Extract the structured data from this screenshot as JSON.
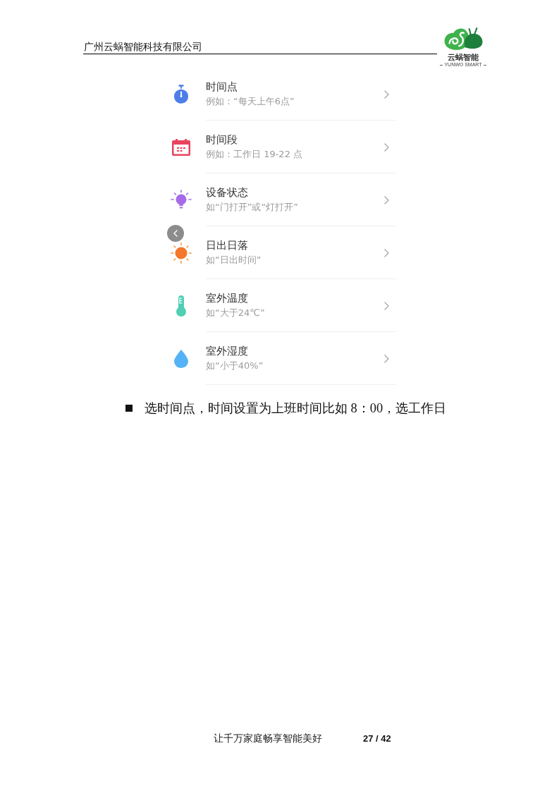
{
  "header": {
    "company": "广州云蜗智能科技有限公司",
    "logo": {
      "name": "云蜗智能",
      "tagline": "YUNWO SMART"
    }
  },
  "screenshot": {
    "conditions": [
      {
        "title": "时间点",
        "example": "例如：“每天上午6点”"
      },
      {
        "title": "时间段",
        "example": "例如：工作日 19-22 点"
      },
      {
        "title": "设备状态",
        "example": "如“门打开”或“灯打开”"
      },
      {
        "title": "日出日落",
        "example": "如“日出时间”"
      },
      {
        "title": "室外温度",
        "example": "如“大于24℃”"
      },
      {
        "title": "室外湿度",
        "example": "如“小于40%”"
      }
    ]
  },
  "instruction": "选时间点，时间设置为上班时间比如 8：00，选工作日",
  "footer": {
    "slogan": "让千万家庭畅享智能美好",
    "page": "27 / 42"
  }
}
